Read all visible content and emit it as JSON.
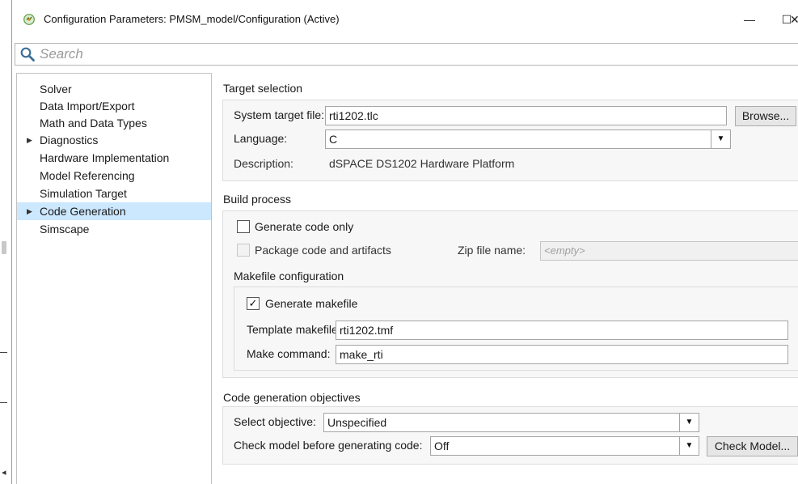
{
  "window": {
    "title": "Configuration Parameters: PMSM_model/Configuration (Active)",
    "minimize": "—",
    "maximize": "☐",
    "close": "✕"
  },
  "search": {
    "placeholder": "Search"
  },
  "tree": {
    "items": [
      {
        "label": "Solver"
      },
      {
        "label": "Data Import/Export"
      },
      {
        "label": "Math and Data Types"
      },
      {
        "label": "Diagnostics"
      },
      {
        "label": "Hardware Implementation"
      },
      {
        "label": "Model Referencing"
      },
      {
        "label": "Simulation Target"
      },
      {
        "label": "Code Generation",
        "selected": true
      },
      {
        "label": "Simscape"
      }
    ],
    "expander": "▶"
  },
  "target_selection": {
    "title": "Target selection",
    "system_target_file_label": "System target file:",
    "system_target_file_value": "rti1202.tlc",
    "browse_label": "Browse...",
    "language_label": "Language:",
    "language_value": "C",
    "description_label": "Description:",
    "description_value": "dSPACE DS1202 Hardware Platform"
  },
  "build_process": {
    "title": "Build process",
    "generate_code_only_label": "Generate code only",
    "generate_code_only_checked": false,
    "package_code_label": "Package code and artifacts",
    "package_code_checked": false,
    "zip_file_name_label": "Zip file name:",
    "zip_file_name_value": "<empty>",
    "makefile_title": "Makefile configuration",
    "generate_makefile_label": "Generate makefile",
    "generate_makefile_checked": true,
    "generate_makefile_mark": "✓",
    "template_makefile_label": "Template makefile:",
    "template_makefile_value": "rti1202.tmf",
    "make_command_label": "Make command:",
    "make_command_value": "make_rti"
  },
  "objectives": {
    "title": "Code generation objectives",
    "select_objective_label": "Select objective:",
    "select_objective_value": "Unspecified",
    "check_model_label": "Check model before generating code:",
    "check_model_value": "Off",
    "check_model_button": "Check Model...",
    "dropdown_arrow": "▼"
  },
  "colors": {
    "selection": "#cce8ff",
    "group_background": "#f7f7f7",
    "button_background": "#e6e6e6"
  }
}
